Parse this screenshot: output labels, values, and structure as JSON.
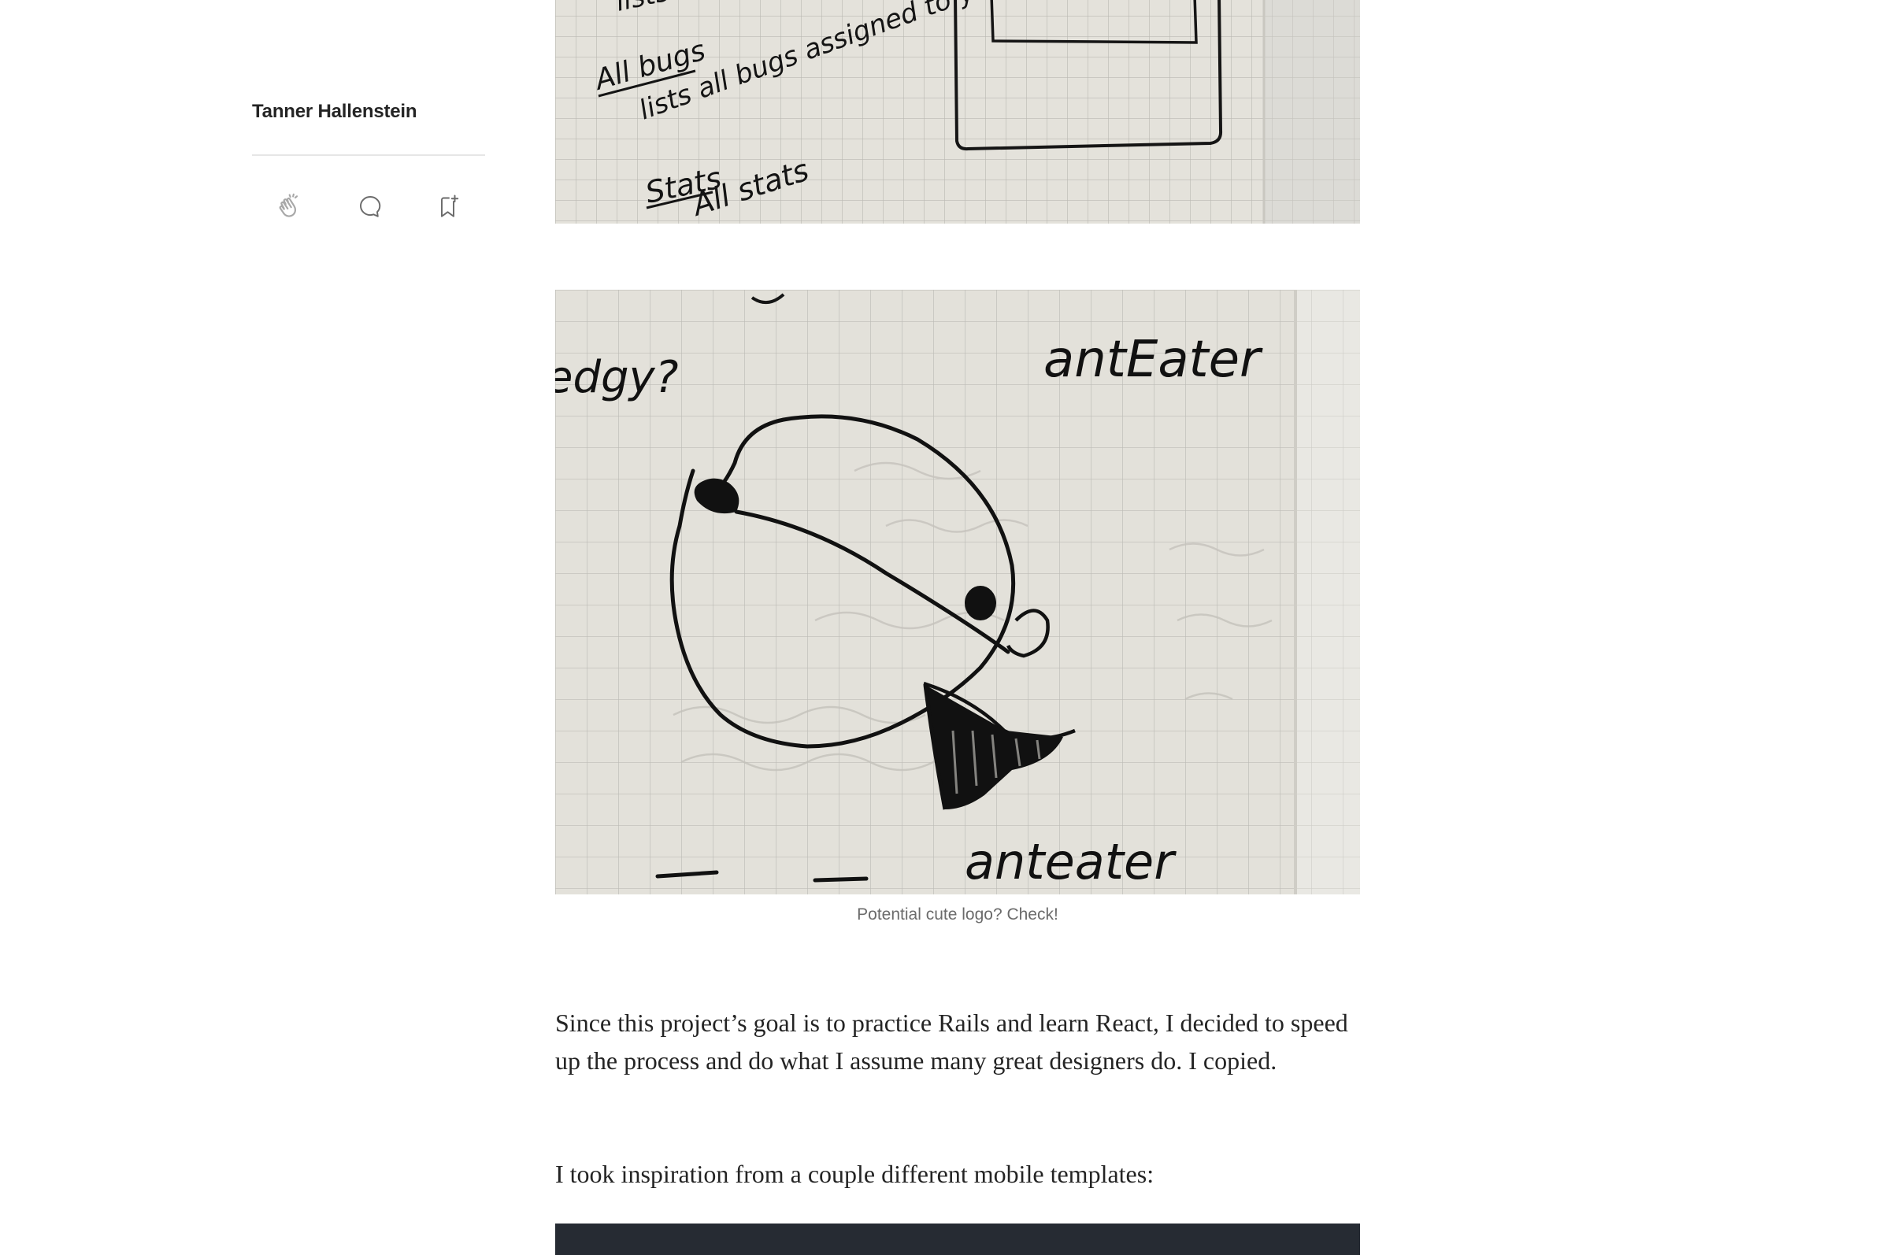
{
  "author": {
    "name": "Tanner Hallenstein"
  },
  "actions": [
    {
      "name": "clap",
      "icon": "clap-icon"
    },
    {
      "name": "respond",
      "icon": "comment-icon"
    },
    {
      "name": "save",
      "icon": "bookmark-add-icon"
    }
  ],
  "sketch_top": {
    "all_bugs_heading": "All bugs",
    "all_bugs_text": "lists all bugs assigned to you? May to filter all",
    "stats_heading": "Stats",
    "stats_text": "All stats",
    "top_fragment": "lists"
  },
  "sketch_logo": {
    "label_top": "antEater",
    "label_bottom": "anteater",
    "left_fragment": "edgy?"
  },
  "caption": "Potential cute logo? Check!",
  "paragraphs": [
    "Since this project’s goal is to practice Rails and learn React, I decided to speed up the process and do what I assume many great designers do. I copied.",
    "I took inspiration from a couple different mobile templates:"
  ],
  "colors": {
    "text": "#242424",
    "muted": "#6b6b6b",
    "divider": "#e6e6e6",
    "dark_figure": "#262b33"
  }
}
